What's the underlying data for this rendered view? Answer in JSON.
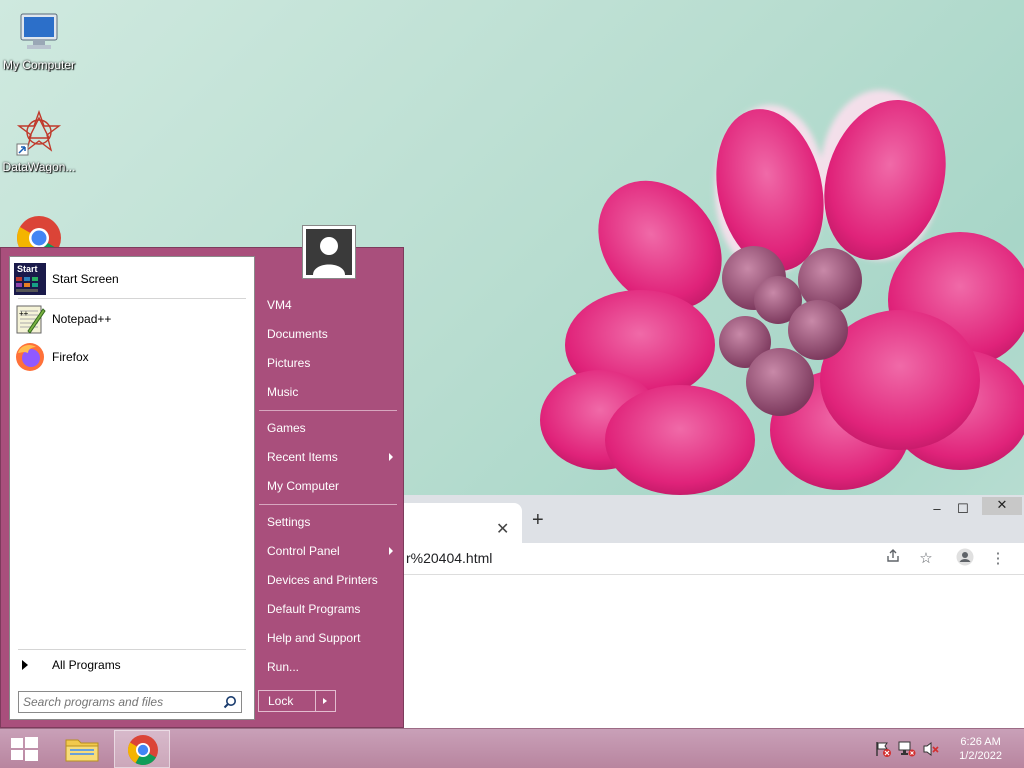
{
  "desktop": {
    "icons": [
      {
        "label": "My Computer",
        "icon": "computer-icon"
      },
      {
        "label": "DataWagon...",
        "icon": "datawagon-icon"
      },
      {
        "label": "",
        "icon": "chrome-icon"
      }
    ]
  },
  "start_menu": {
    "pinned": [
      {
        "label": "Start Screen",
        "icon": "start-screen-icon"
      },
      {
        "label": "Notepad++",
        "icon": "notepadpp-icon"
      },
      {
        "label": "Firefox",
        "icon": "firefox-icon"
      }
    ],
    "start_screen_badge": "Start",
    "all_programs": "All Programs",
    "search_placeholder": "Search programs and files",
    "right_items": [
      {
        "label": "VM4"
      },
      {
        "label": "Documents"
      },
      {
        "label": "Pictures"
      },
      {
        "label": "Music"
      },
      {
        "label": "Games"
      },
      {
        "label": "Recent Items",
        "submenu": true
      },
      {
        "label": "My Computer"
      },
      {
        "label": "Settings"
      },
      {
        "label": "Control Panel",
        "submenu": true
      },
      {
        "label": "Devices and Printers"
      },
      {
        "label": "Default Programs"
      },
      {
        "label": "Help and Support"
      },
      {
        "label": "Run..."
      }
    ],
    "lock_label": "Lock",
    "accent_color": "#a94f7c"
  },
  "browser": {
    "tab_close": "✕",
    "new_tab": "+",
    "url_fragment": "r%20404.html",
    "window_buttons": [
      "–",
      "☐",
      "✕"
    ]
  },
  "taskbar": {
    "clock_time": "6:26 AM",
    "clock_date": "1/2/2022",
    "tray_icons": [
      "action-center-flag-icon",
      "network-icon",
      "volume-muted-icon"
    ]
  }
}
